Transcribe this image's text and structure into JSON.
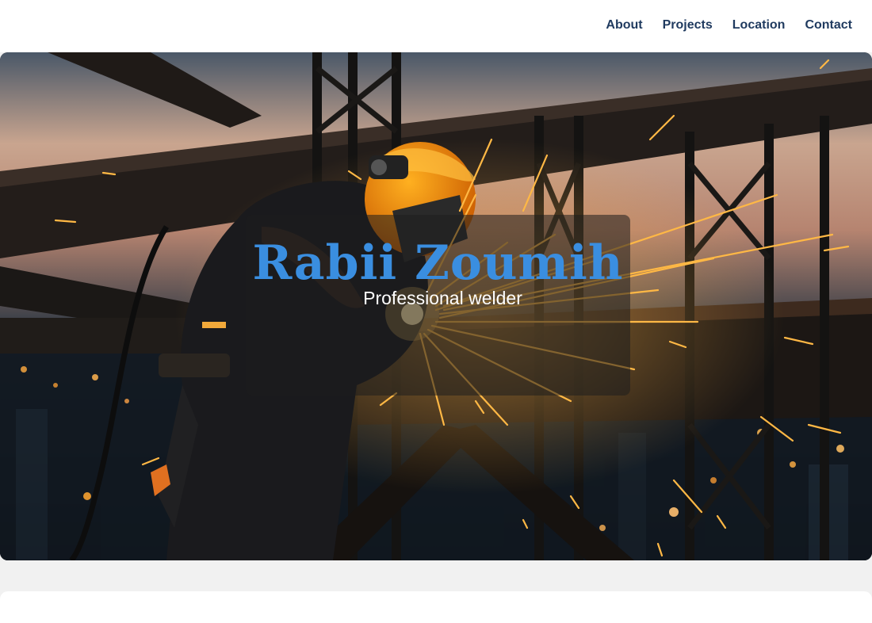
{
  "nav": {
    "items": [
      {
        "label": "About"
      },
      {
        "label": "Projects"
      },
      {
        "label": "Location"
      },
      {
        "label": "Contact"
      }
    ]
  },
  "hero": {
    "title": "Rabii Zoumih",
    "subtitle": "Professional welder"
  },
  "colors": {
    "nav_text": "#1f3a5f",
    "title": "#3a8ee0",
    "page_bg": "#f1f1f1"
  }
}
